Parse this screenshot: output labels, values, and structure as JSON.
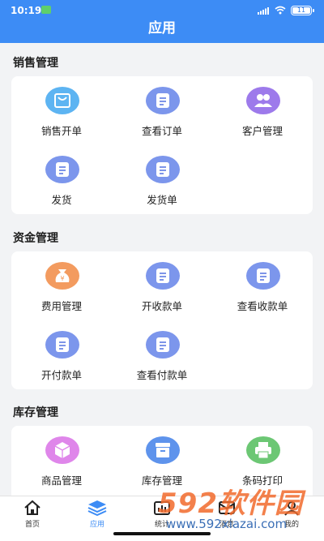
{
  "status": {
    "time": "10:19",
    "battery": "11"
  },
  "header": {
    "title": "应用"
  },
  "sections": [
    {
      "title": "销售管理",
      "items": [
        {
          "label": "销售开单",
          "icon": "cart-icon",
          "color": "#5db4f2"
        },
        {
          "label": "查看订单",
          "icon": "document-icon",
          "color": "#7c96ec"
        },
        {
          "label": "客户管理",
          "icon": "users-icon",
          "color": "#9d7aeb"
        },
        {
          "label": "发货",
          "icon": "document-icon",
          "color": "#7c96ec"
        },
        {
          "label": "发货单",
          "icon": "document-icon",
          "color": "#7c96ec"
        }
      ]
    },
    {
      "title": "资金管理",
      "items": [
        {
          "label": "费用管理",
          "icon": "money-bag-icon",
          "color": "#f39b5f"
        },
        {
          "label": "开收款单",
          "icon": "document-icon",
          "color": "#7c96ec"
        },
        {
          "label": "查看收款单",
          "icon": "document-icon",
          "color": "#7c96ec"
        },
        {
          "label": "开付款单",
          "icon": "document-icon",
          "color": "#7c96ec"
        },
        {
          "label": "查看付款单",
          "icon": "document-icon",
          "color": "#7c96ec"
        }
      ]
    },
    {
      "title": "库存管理",
      "items": [
        {
          "label": "商品管理",
          "icon": "box-icon",
          "color": "#df86ea"
        },
        {
          "label": "库存管理",
          "icon": "warehouse-icon",
          "color": "#5e93ec"
        },
        {
          "label": "条码打印",
          "icon": "printer-icon",
          "color": "#6cc774"
        }
      ]
    }
  ],
  "tabs": [
    {
      "label": "首页",
      "icon": "home-icon"
    },
    {
      "label": "应用",
      "icon": "apps-icon",
      "active": true
    },
    {
      "label": "统计",
      "icon": "stats-icon"
    },
    {
      "label": "消息",
      "icon": "message-icon"
    },
    {
      "label": "我的",
      "icon": "user-icon"
    }
  ],
  "watermark": {
    "brand": "592软件园",
    "url": "www.592xiazai.com"
  },
  "colors": {
    "accent": "#3d8cf5",
    "background": "#f2f3f5"
  }
}
